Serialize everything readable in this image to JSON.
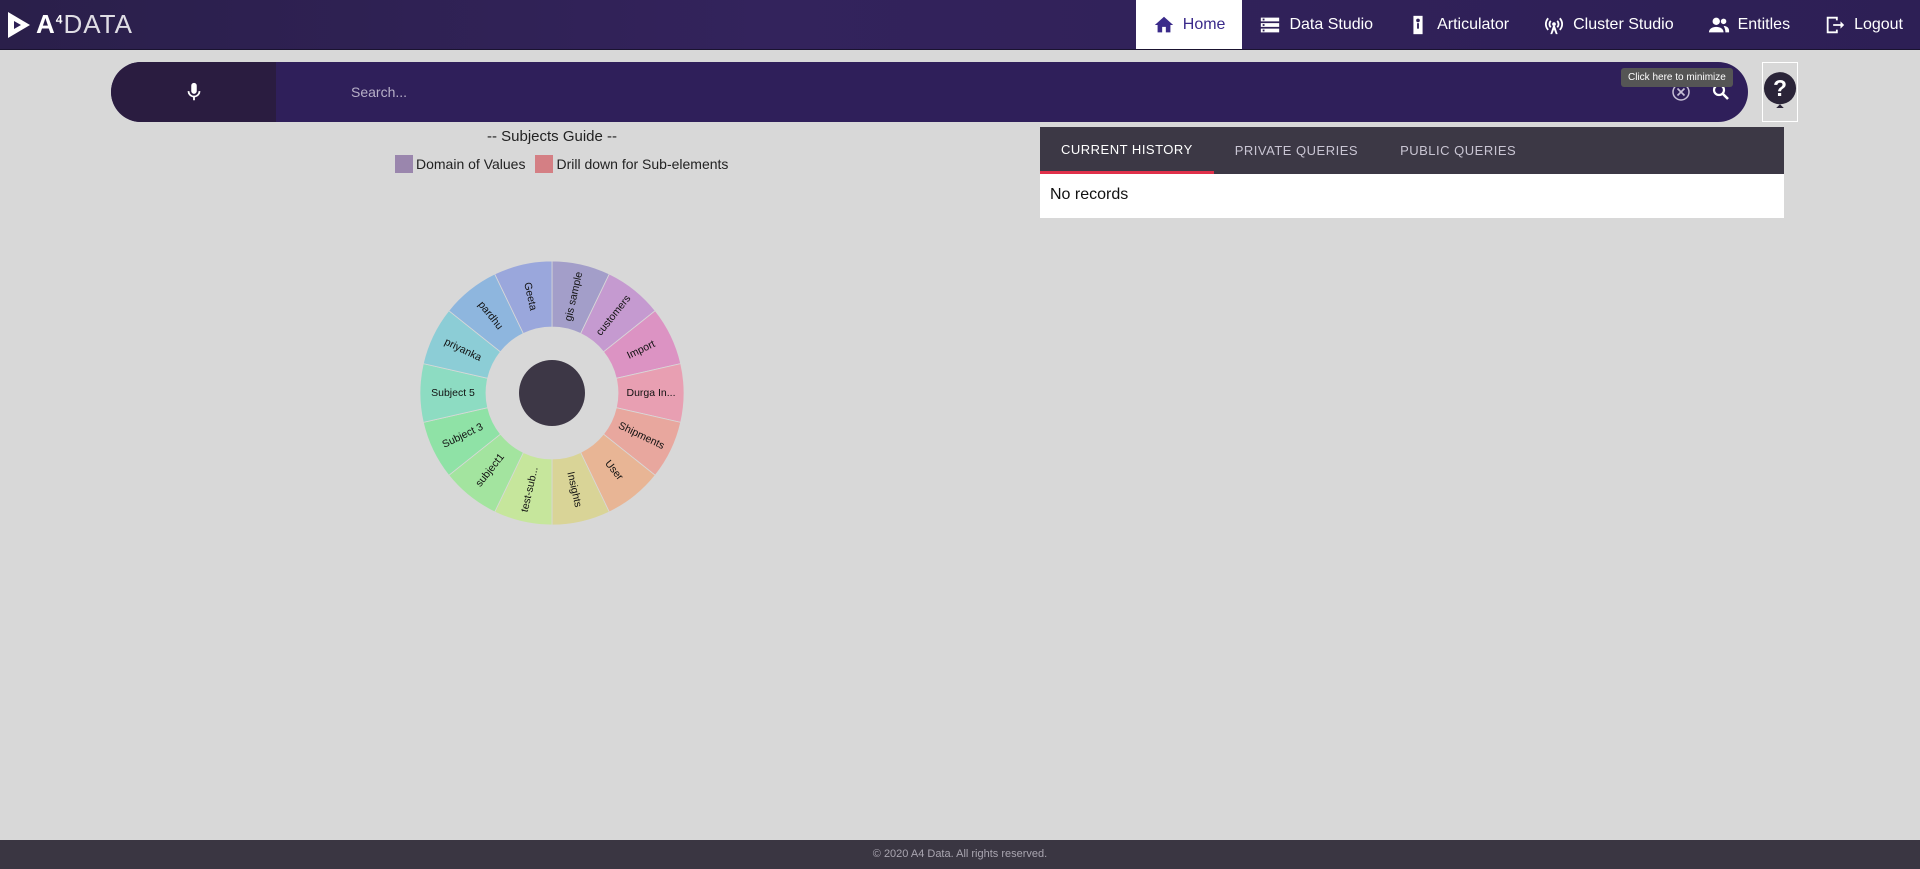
{
  "header": {
    "logo_text_a": "A",
    "logo_text_sup": "4",
    "logo_text_data": "DATA",
    "nav": [
      {
        "label": "Home",
        "icon": "home-icon",
        "active": true
      },
      {
        "label": "Data Studio",
        "icon": "database-icon"
      },
      {
        "label": "Articulator",
        "icon": "articulator-icon"
      },
      {
        "label": "Cluster Studio",
        "icon": "antenna-icon"
      },
      {
        "label": "Entitles",
        "icon": "people-icon"
      },
      {
        "label": "Logout",
        "icon": "logout-icon"
      }
    ]
  },
  "search": {
    "placeholder": "Search...",
    "value": "",
    "tooltip": "Click here to minimize"
  },
  "guide": {
    "title": "-- Subjects Guide --",
    "legend": [
      {
        "label": "Domain of Values",
        "color": "#9a86ad"
      },
      {
        "label": "Drill down for Sub-elements",
        "color": "#d47f84"
      }
    ],
    "segments": [
      {
        "label": "gis sample",
        "color": "#a39ec9"
      },
      {
        "label": "customers",
        "color": "#c59ad0"
      },
      {
        "label": "Import",
        "color": "#dc93c3"
      },
      {
        "label": "Durga In...",
        "color": "#e89fb2"
      },
      {
        "label": "Shipments",
        "color": "#e8a79e"
      },
      {
        "label": "User",
        "color": "#e8b595"
      },
      {
        "label": "Insights",
        "color": "#d9d497"
      },
      {
        "label": "test-sub...",
        "color": "#c6e69c"
      },
      {
        "label": "subject1",
        "color": "#a3e49f"
      },
      {
        "label": "Subject 3",
        "color": "#8fe2a6"
      },
      {
        "label": "Subject 5",
        "color": "#8ddcc2"
      },
      {
        "label": "priyanka",
        "color": "#8ccdd6"
      },
      {
        "label": "pardhu",
        "color": "#8eb6de"
      },
      {
        "label": "Geeta",
        "color": "#9aa7dc"
      }
    ],
    "center_color": "#3d3746"
  },
  "history": {
    "tabs": [
      "CURRENT HISTORY",
      "PRIVATE QUERIES",
      "PUBLIC QUERIES"
    ],
    "empty_text": "No records"
  },
  "footer": {
    "text": "© 2020 A4 Data. All rights reserved."
  }
}
